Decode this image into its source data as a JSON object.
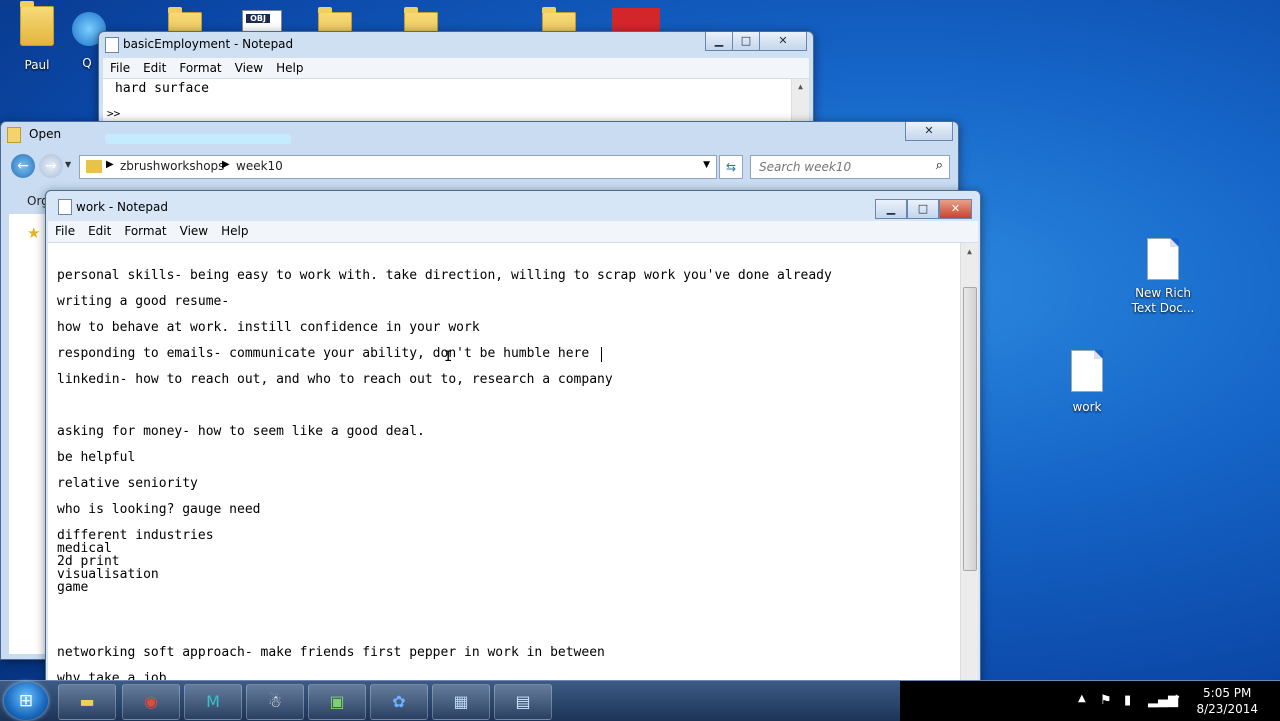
{
  "desktop": {
    "icons": [
      {
        "label": "Paul"
      },
      {
        "label": "Q"
      },
      {
        "label": "New Rich Text Doc..."
      },
      {
        "label": "work"
      }
    ],
    "obj_badge": "OBJ"
  },
  "notepad_bg": {
    "title": "basicEmployment - Notepad",
    "menu": [
      "File",
      "Edit",
      "Format",
      "View",
      "Help"
    ],
    "lines": [
      "hard surface",
      "",
      ">>"
    ]
  },
  "open_dialog": {
    "title": "Open",
    "path": [
      "zbrushworkshops",
      "week10"
    ],
    "search_placeholder": "Search week10",
    "left_label": "Org"
  },
  "notepad": {
    "title": "work - Notepad",
    "menu": [
      "File",
      "Edit",
      "Format",
      "View",
      "Help"
    ],
    "lines": [
      "personal skills- being easy to work with. take direction, willing to scrap work you've done already",
      "writing a good resume-",
      "how to behave at work. instill confidence in your work",
      "responding to emails- communicate your ability, don't be humble here",
      "linkedin- how to reach out, and who to reach out to, research a company",
      "asking for money- how to seem like a good deal.",
      "be helpful",
      "relative seniority",
      "who is looking? gauge need",
      "different industries",
      "medical",
      "2d print",
      "visualisation",
      "game",
      "networking soft approach- make friends first pepper in work in between",
      "why take a job"
    ]
  },
  "taskbar": {
    "time": "5:05 PM",
    "date": "8/23/2014"
  }
}
